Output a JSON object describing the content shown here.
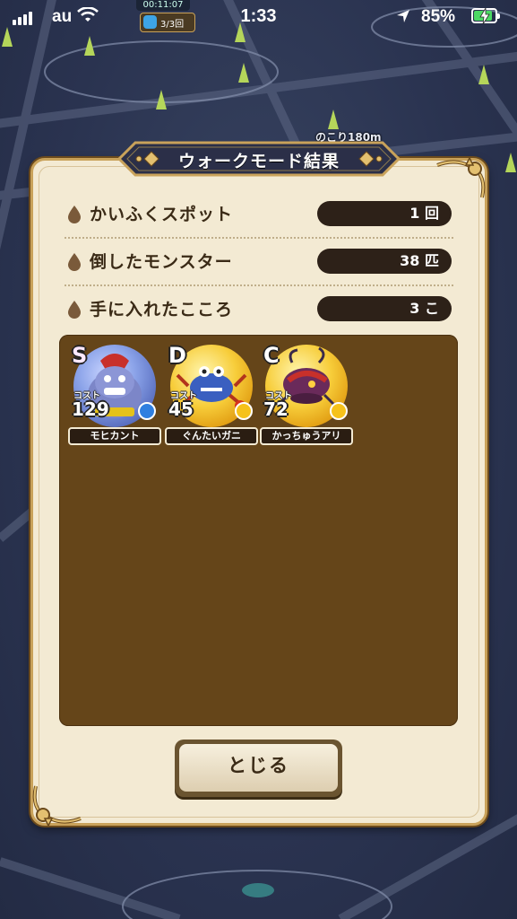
{
  "status_bar": {
    "carrier": "au",
    "time": "1:33",
    "battery_percent": "85%",
    "signal_bars": 4,
    "battery_level": 0.85,
    "charging": true
  },
  "map_overlay": {
    "timer": "00:11:07",
    "walk_count": "3/3回",
    "remaining": "のこり180m"
  },
  "dialog": {
    "title": "ウォークモード結果",
    "rows": [
      {
        "label": "かいふくスポット",
        "value": "1 回",
        "icon": "drop-icon"
      },
      {
        "label": "倒したモンスター",
        "value": "38 匹",
        "icon": "drop-icon"
      },
      {
        "label": "手に入れたこころ",
        "value": "3 こ",
        "icon": "drop-icon"
      }
    ],
    "cost_label": "コスト",
    "hearts": [
      {
        "rank": "S",
        "cost": "129",
        "name": "モヒカント",
        "orb_color": "#5a8ad6",
        "gem_color": "#2f7fe0"
      },
      {
        "rank": "D",
        "cost": "45",
        "name": "ぐんたいガニ",
        "orb_color": "#f2b21a",
        "gem_color": "#f6c21a"
      },
      {
        "rank": "C",
        "cost": "72",
        "name": "かっちゅうアリ",
        "orb_color": "#f2b21a",
        "gem_color": "#f6c21a"
      }
    ],
    "close_label": "とじる"
  },
  "colors": {
    "panel_bg": "#f3ead3",
    "gold_border": "#c9a25a",
    "title_plate": "#2b2f48",
    "value_pill": "#2d2118",
    "hearts_box": "#654519"
  }
}
